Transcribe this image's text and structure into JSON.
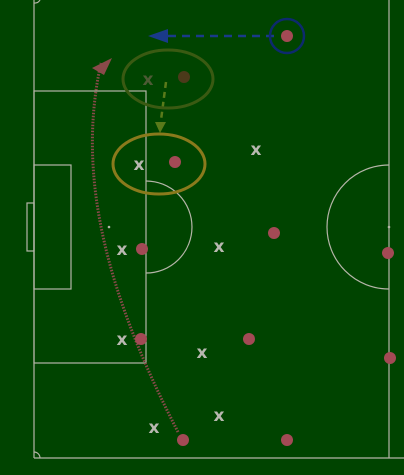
{
  "colors": {
    "pitch": "#004400",
    "lines": "#b5b5a8",
    "player": "#a34a55",
    "player_faded": "#4b3a1a",
    "opponent_marker": "#b8b8b0",
    "opponent_marker_faded": "#4d5a35",
    "highlight_gold": "#8a7a1c",
    "highlight_faded": "#3a5a12",
    "highlight_blue": "#0d2a6e",
    "run_arrow": "#8a4a4a",
    "pass_arrow": "#1a3a8a",
    "shift_arrow": "#5a7a1a"
  },
  "icons": {
    "player": "filled-circle",
    "opponent": "x-mark",
    "ring": "circle-outline",
    "arrow": "arrowhead"
  },
  "opponent_label": "x"
}
